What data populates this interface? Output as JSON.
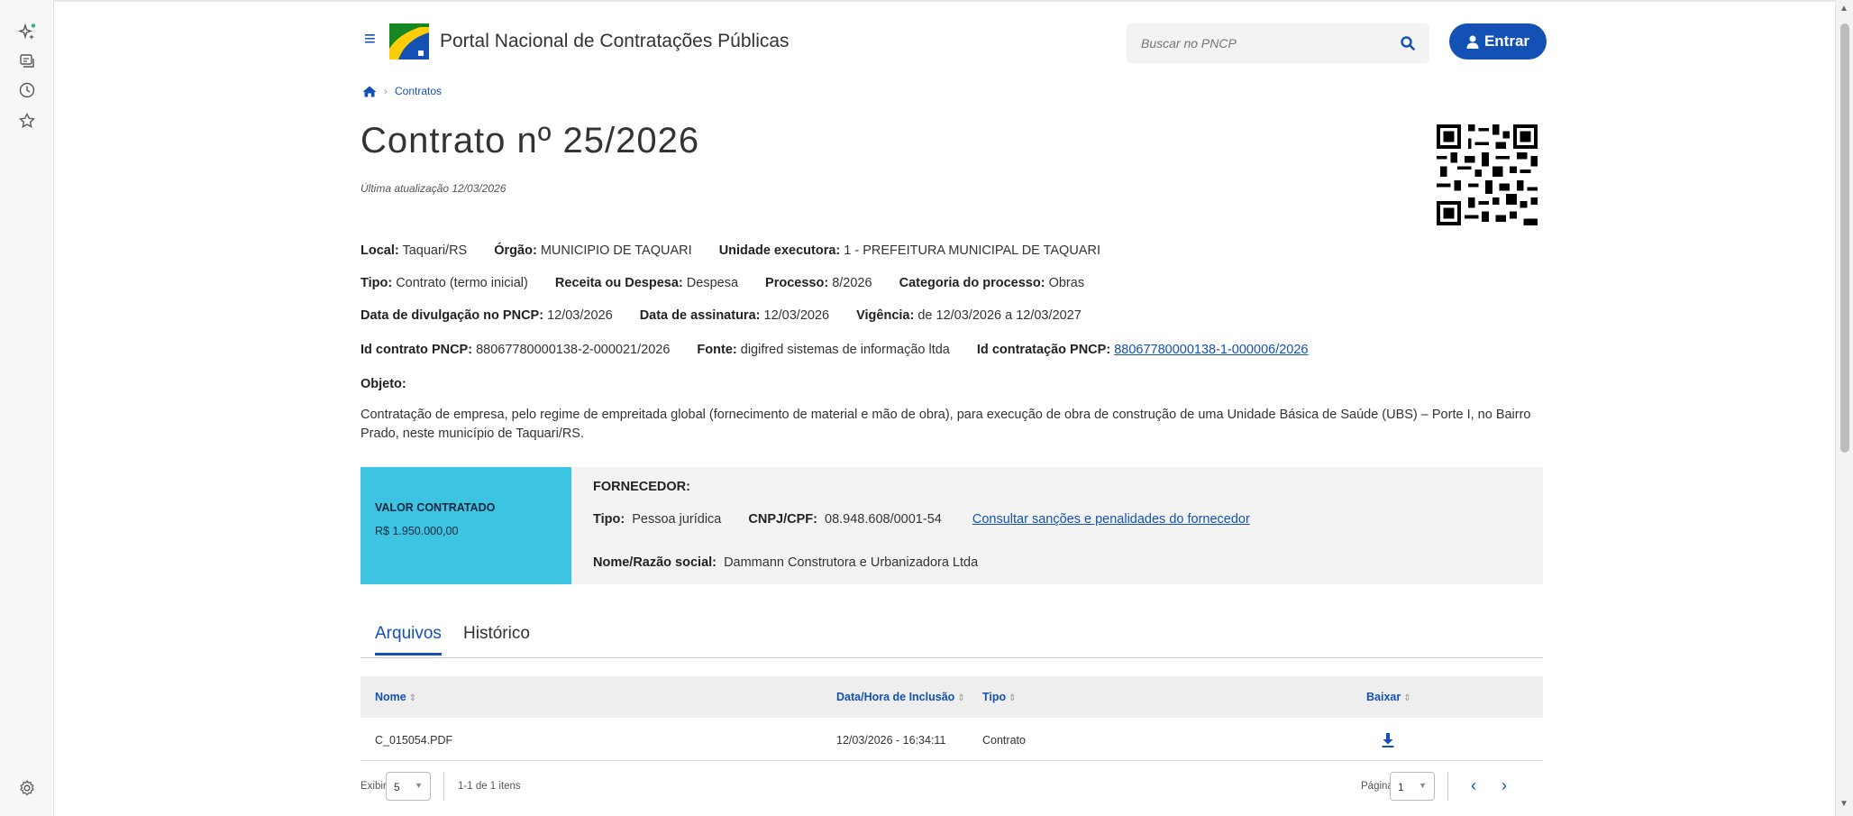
{
  "header": {
    "portal_title": "Portal Nacional de Contratações Públicas",
    "search_placeholder": "Buscar no PNCP",
    "login_label": "Entrar"
  },
  "breadcrumb": {
    "current": "Contratos"
  },
  "title": "Contrato nº 25/2026",
  "updated": "Última atualização 12/03/2026",
  "info": {
    "local_label": "Local:",
    "local": "Taquari/RS",
    "orgao_label": "Órgão:",
    "orgao": "MUNICIPIO DE TAQUARI",
    "unidade_label": "Unidade executora:",
    "unidade": "1 - PREFEITURA MUNICIPAL DE TAQUARI",
    "tipo_label": "Tipo:",
    "tipo": "Contrato (termo inicial)",
    "receita_label": "Receita ou Despesa:",
    "receita": "Despesa",
    "processo_label": "Processo:",
    "processo": "8/2026",
    "categoria_label": "Categoria do processo:",
    "categoria": "Obras",
    "divulgacao_label": "Data de divulgação no PNCP:",
    "divulgacao": "12/03/2026",
    "assinatura_label": "Data de assinatura:",
    "assinatura": "12/03/2026",
    "vigencia_label": "Vigência:",
    "vigencia": "de 12/03/2026 a 12/03/2027",
    "id_contrato_label": "Id contrato PNCP:",
    "id_contrato": "88067780000138-2-000021/2026",
    "fonte_label": "Fonte:",
    "fonte": "digifred sistemas de informação ltda",
    "id_contratacao_label": "Id contratação PNCP:",
    "id_contratacao": "88067780000138-1-000006/2026"
  },
  "objeto": {
    "label": "Objeto:",
    "text": "Contratação de empresa, pelo regime de empreitada global (fornecimento de material e mão de obra), para execução de obra de construção de uma Unidade Básica de Saúde (UBS) – Porte I, no Bairro Prado, neste município de Taquari/RS."
  },
  "valor": {
    "label": "VALOR CONTRATADO",
    "amount": "R$ 1.950.000,00"
  },
  "fornecedor": {
    "title": "FORNECEDOR:",
    "tipo_label": "Tipo:",
    "tipo": "Pessoa jurídica",
    "cnpj_label": "CNPJ/CPF:",
    "cnpj": "08.948.608/0001-54",
    "sancoes_link": "Consultar sanções e penalidades do fornecedor",
    "razao_label": "Nome/Razão social:",
    "razao": "Dammann Construtora e Urbanizadora Ltda"
  },
  "tabs": [
    "Arquivos",
    "Histórico"
  ],
  "table": {
    "columns": [
      "Nome",
      "Data/Hora de Inclusão",
      "Tipo",
      "Baixar"
    ],
    "rows": [
      {
        "nome": "C_015054.PDF",
        "data": "12/03/2026 - 16:34:11",
        "tipo": "Contrato"
      }
    ]
  },
  "pagination": {
    "exibir_label": "Exibir:",
    "page_size": "5",
    "range": "1-1 de 1 itens",
    "pagina_label": "Página:",
    "page": "1"
  },
  "colors": {
    "primary": "#1351b4",
    "accent": "#3cc4e2"
  }
}
